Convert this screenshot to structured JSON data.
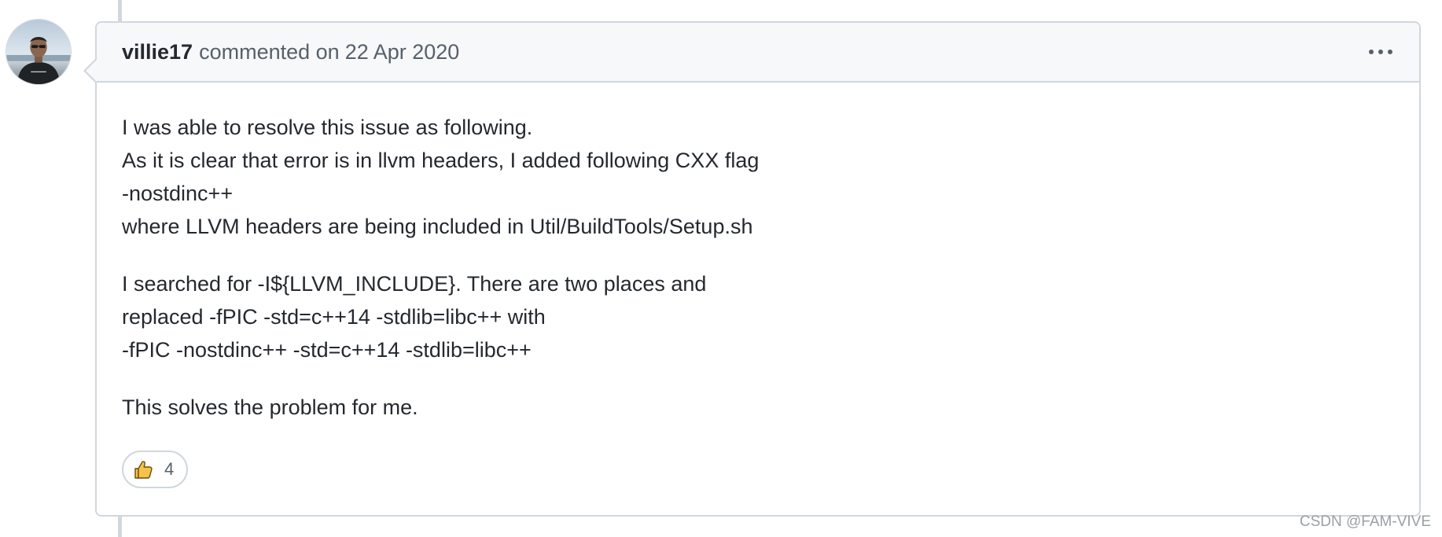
{
  "comment": {
    "author": "villie17",
    "action": "commented on",
    "date": "22 Apr 2020",
    "menu_icon": "kebab-horizontal-icon",
    "paragraphs": [
      [
        "I was able to resolve this issue as following.",
        "As it is clear that error is in llvm headers, I added following CXX flag",
        "-nostdinc++",
        "where LLVM headers are being included in Util/BuildTools/Setup.sh"
      ],
      [
        "I searched for -I${LLVM_INCLUDE}. There are two places and",
        "replaced -fPIC -std=c++14 -stdlib=libc++ with",
        "-fPIC -nostdinc++ -std=c++14 -stdlib=libc++"
      ],
      [
        "This solves the problem for me."
      ]
    ],
    "reactions": [
      {
        "emoji": "thumbs-up-icon",
        "count": "4"
      }
    ]
  },
  "watermark": "CSDN @FAM-VIVE",
  "colors": {
    "border": "#d0d7de",
    "header_bg": "#f6f8fa",
    "text": "#24292f",
    "muted": "#57606a"
  }
}
